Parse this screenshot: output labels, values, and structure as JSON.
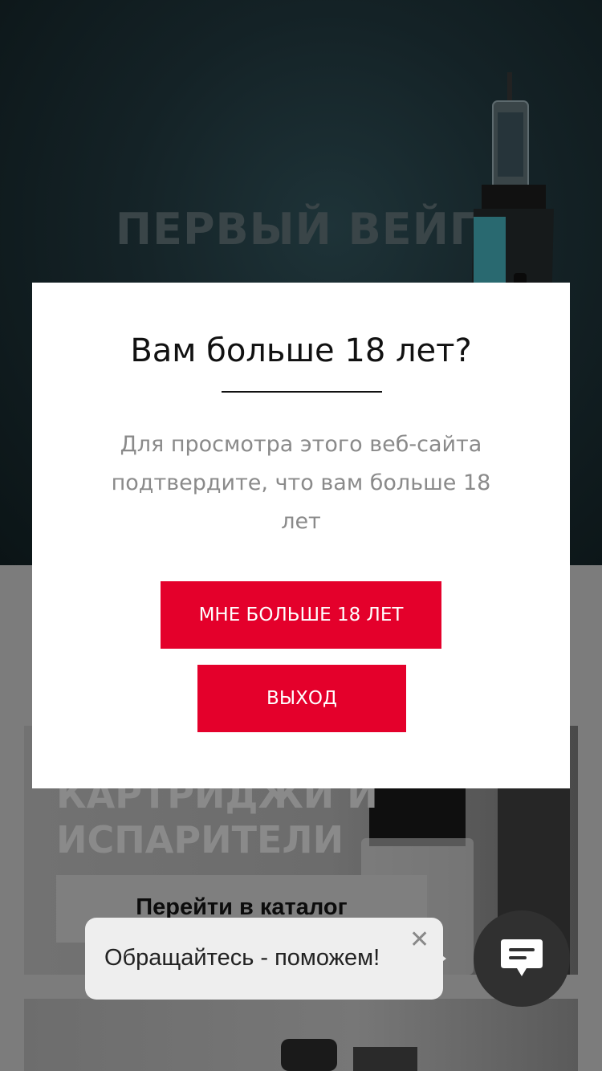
{
  "hero": {
    "title": "ПЕРВЫЙ ВЕЙП"
  },
  "cards": [
    {
      "title": "КАРТРИДЖИ И\nИСПАРИТЕЛИ",
      "button_label": "Перейти в каталог"
    }
  ],
  "age_modal": {
    "title": "Вам больше 18 лет?",
    "text": "Для просмотра этого веб-сайта подтвердите, что вам больше 18 лет",
    "confirm_label": "МНЕ БОЛЬШЕ 18 ЛЕТ",
    "exit_label": "ВЫХОД"
  },
  "chat": {
    "message": "Обращайтесь - поможем!",
    "close_glyph": "✕",
    "icon": "chat-icon"
  },
  "colors": {
    "accent": "#e4002b",
    "chat_button": "#303030"
  }
}
